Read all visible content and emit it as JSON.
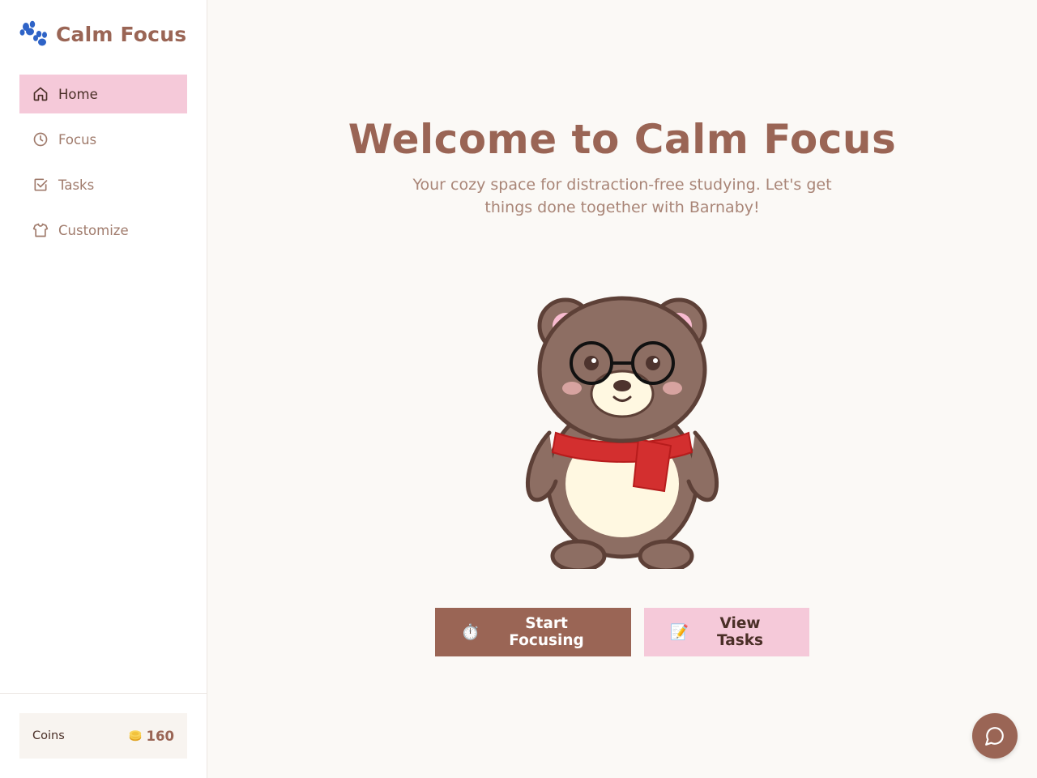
{
  "brand": {
    "title": "Calm Focus",
    "icon": "paw-icon"
  },
  "nav": {
    "items": [
      {
        "label": "Home",
        "icon": "home-icon",
        "active": true
      },
      {
        "label": "Focus",
        "icon": "clock-icon",
        "active": false
      },
      {
        "label": "Tasks",
        "icon": "checkbox-icon",
        "active": false
      },
      {
        "label": "Customize",
        "icon": "shirt-icon",
        "active": false
      }
    ]
  },
  "coins": {
    "label": "Coins",
    "value": "160",
    "icon": "coin-icon"
  },
  "hero": {
    "title": "Welcome to Calm Focus",
    "subtitle": "Your cozy space for distraction-free studying. Let's get things done together with Barnaby!"
  },
  "actions": {
    "start_label": "Start Focusing",
    "start_icon": "⏱️",
    "tasks_label": "View Tasks",
    "tasks_icon": "📝"
  },
  "colors": {
    "accent": "#9a6555",
    "pink": "#f5c9d9",
    "background": "#fbf9f6"
  }
}
